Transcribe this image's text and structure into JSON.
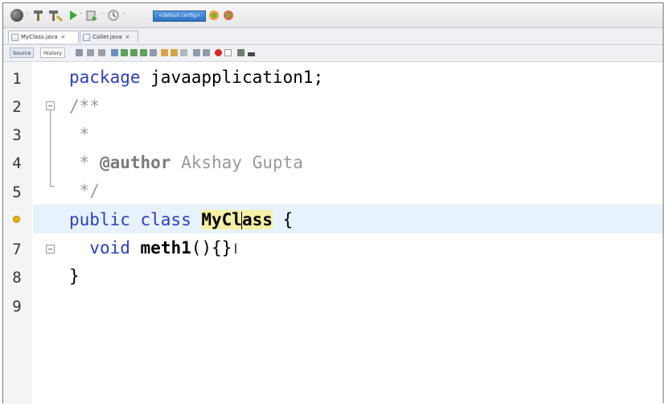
{
  "toolbar": {
    "combo_text": "<default config>",
    "icons": [
      "globe-icon",
      "hammer-icon",
      "clean-build-icon",
      "run-icon",
      "debug-icon",
      "profile-icon",
      "gc-icon",
      "gc-icon-2"
    ]
  },
  "tabs": [
    {
      "label": "MyClass.java",
      "active": true
    },
    {
      "label": "Caller.java",
      "active": false
    }
  ],
  "editor_toolbar": {
    "source_label": "Source",
    "history_label": "History"
  },
  "editor": {
    "line_numbers": [
      "1",
      "2",
      "3",
      "4",
      "5",
      "",
      "7",
      "8",
      "9"
    ],
    "lines": {
      "l1_kw": "package",
      "l1_rest": " javaapplication1;",
      "l2": "/**",
      "l3": " *",
      "l4_star": " * ",
      "l4_tag": "@author",
      "l4_name": " Akshay Gupta",
      "l5": " */",
      "l6_kw1": "public",
      "l6_kw2": " class",
      "l6_name_a": "MyCl",
      "l6_name_b": "ass",
      "l6_rest": " {",
      "l7_kw": "void",
      "l7_meth": "meth1",
      "l7_rest": "(){}",
      "l8": "}"
    },
    "highlight_color": "#e8f2fe",
    "keyword_color": "#2b3fbf"
  }
}
